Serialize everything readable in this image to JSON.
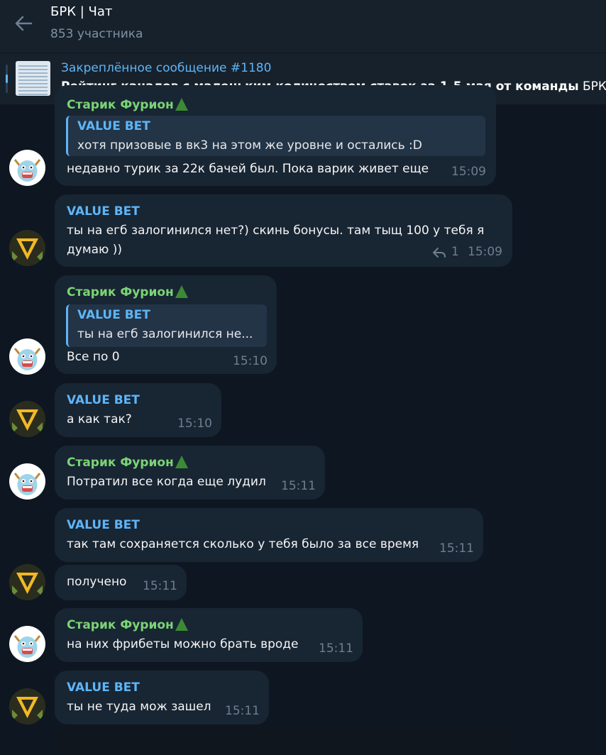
{
  "header": {
    "title": "БРК | Чат",
    "subtitle": "853 участника"
  },
  "pinned": {
    "label": "Закреплённое сообщение #1180",
    "text_bold": "Рейтинг каналов с маленьким количеством ставок за 1-5 мая от команды",
    "text_tail": " БРК"
  },
  "messages": [
    {
      "sender": "Старик Фурион",
      "quote_name": "VALUE BET",
      "quote_text": "хотя призовые в вк3 на этом же уровне и остались :D",
      "text": "недавно турик за 22к бачей был. Пока варик живет еще",
      "time": "15:09"
    },
    {
      "sender": "VALUE BET",
      "text_line1": "ты на егб залогинился нет?) скинь бонусы. там тыщ 100 у тебя я",
      "text_line2": "думаю ))",
      "replies": "1",
      "time": "15:09"
    },
    {
      "sender": "Старик Фурион",
      "quote_name": "VALUE BET",
      "quote_text": "ты на егб залогинился не...",
      "text": "Все по 0",
      "time": "15:10"
    },
    {
      "sender": "VALUE BET",
      "text": "а как так?",
      "time": "15:10"
    },
    {
      "sender": "Старик Фурион",
      "text": "Потратил все когда еще лудил",
      "time": "15:11"
    },
    {
      "sender": "VALUE BET",
      "text": "так там сохраняется сколько у тебя было за все время",
      "time": "15:11"
    },
    {
      "text": "получено",
      "time": "15:11"
    },
    {
      "sender": "Старик Фурион",
      "text": "на них фрибеты можно брать вроде",
      "time": "15:11"
    },
    {
      "sender": "VALUE BET",
      "text": "ты не туда мож зашел",
      "time": "15:11"
    }
  ]
}
